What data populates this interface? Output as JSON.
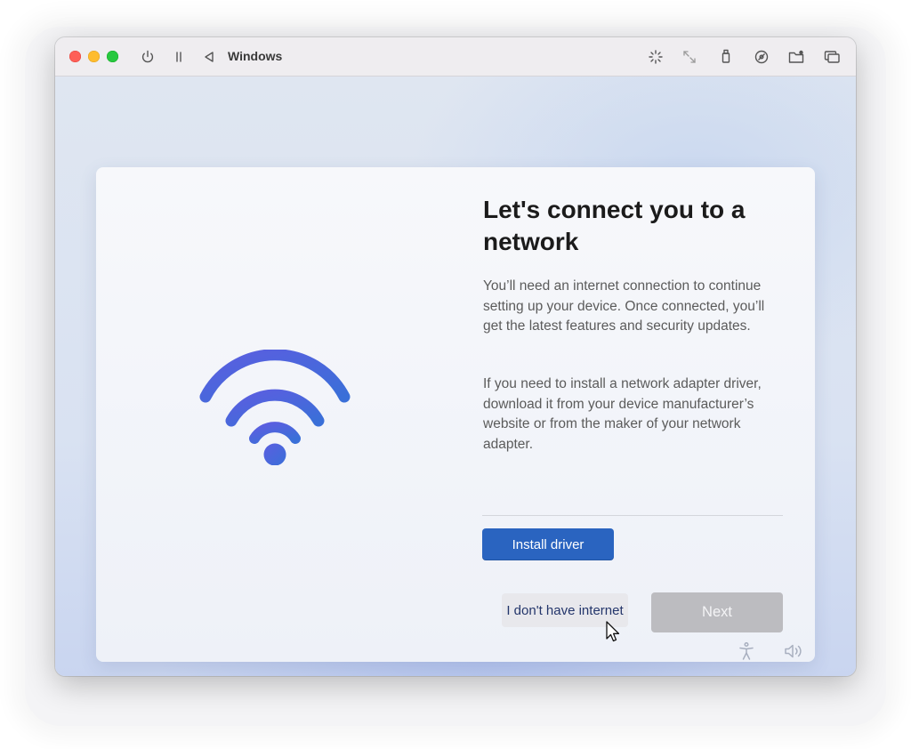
{
  "window": {
    "title": "Windows"
  },
  "titlebar": {
    "left_icons": [
      "power-icon",
      "pause-icon",
      "back-icon"
    ],
    "right_icons": [
      "brightness-icon",
      "resize-icon",
      "usb-icon",
      "disc-icon",
      "shared-folder-icon",
      "windows-stack-icon"
    ]
  },
  "setup": {
    "heading": "Let's connect you to a network",
    "paragraph1": "You’ll need an internet connection to continue setting up your device. Once connected, you’ll get the latest features and security updates.",
    "paragraph2": "If you need to install a network adapter driver, download it from your device manufacturer’s website or from the maker of your network adapter.",
    "install_driver_label": "Install driver",
    "no_internet_label": "I don't have internet",
    "next_label": "Next",
    "wifi_icon": "wifi-icon"
  },
  "bottom_bar": {
    "icons": [
      "accessibility-icon",
      "volume-icon"
    ]
  },
  "colors": {
    "accent": "#2a64c0",
    "wifi_gradient_start": "#5b5ee0",
    "wifi_gradient_end": "#3a6fd8",
    "next_disabled": "#bcbcc0"
  }
}
